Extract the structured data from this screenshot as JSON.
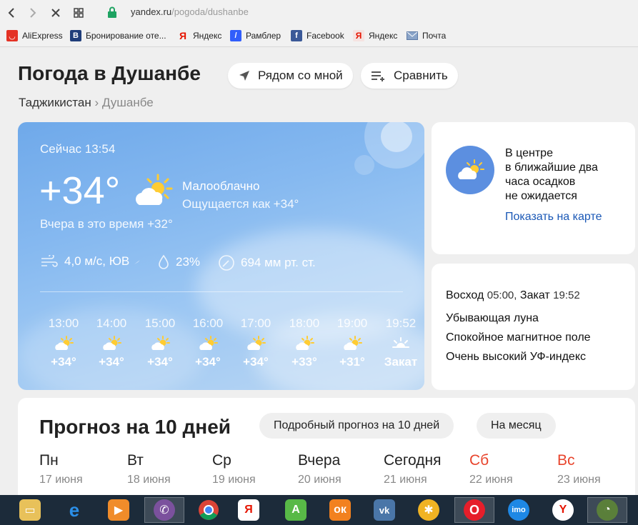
{
  "browser": {
    "url_host": "yandex.ru",
    "url_path": "/pogoda/dushanbe",
    "bookmarks": [
      {
        "label": "AliExpress",
        "icon": "aliexpress-icon"
      },
      {
        "label": "Бронирование оте...",
        "icon": "booking-icon"
      },
      {
        "label": "Яндекс",
        "icon": "yandex-icon"
      },
      {
        "label": "Рамблер",
        "icon": "rambler-icon"
      },
      {
        "label": "Facebook",
        "icon": "facebook-icon"
      },
      {
        "label": "Яндекс",
        "icon": "yandex-icon"
      },
      {
        "label": "Почта",
        "icon": "mail-icon"
      }
    ]
  },
  "header": {
    "title": "Погода в Душанбе",
    "nearby_label": "Рядом со мной",
    "compare_label": "Сравнить"
  },
  "breadcrumb": {
    "country": "Таджикистан",
    "separator": "›",
    "city": "Душанбе"
  },
  "current": {
    "time_label": "Сейчас 13:54",
    "temperature": "+34°",
    "condition": "Малооблачно",
    "feels_like": "Ощущается как +34°",
    "yesterday": "Вчера в это время +32°",
    "wind": "4,0 м/с, ЮВ",
    "humidity": "23%",
    "pressure": "694 мм рт. ст."
  },
  "hourly": [
    {
      "time": "13:00",
      "value": "+34°",
      "icon": "partly-cloudy-icon"
    },
    {
      "time": "14:00",
      "value": "+34°",
      "icon": "partly-cloudy-icon"
    },
    {
      "time": "15:00",
      "value": "+34°",
      "icon": "partly-cloudy-icon"
    },
    {
      "time": "16:00",
      "value": "+34°",
      "icon": "partly-cloudy-icon"
    },
    {
      "time": "17:00",
      "value": "+34°",
      "icon": "partly-cloudy-icon"
    },
    {
      "time": "18:00",
      "value": "+33°",
      "icon": "partly-cloudy-icon"
    },
    {
      "time": "19:00",
      "value": "+31°",
      "icon": "partly-cloudy-icon"
    },
    {
      "time": "19:52",
      "value": "Закат",
      "icon": "sunset-icon"
    }
  ],
  "precipitation": {
    "line1": "В центре",
    "line2": "в ближайшие два",
    "line3": "часа осадков",
    "line4": "не ожидается",
    "map_link": "Показать на карте"
  },
  "sun_info": {
    "sunrise_label": "Восход",
    "sunrise_time": "05:00,",
    "sunset_label": "Закат",
    "sunset_time": "19:52",
    "moon": "Убывающая луна",
    "magnetic": "Спокойное магнитное поле",
    "uv": "Очень высокий УФ-индекс"
  },
  "forecast": {
    "title": "Прогноз на 10 дней",
    "detailed_label": "Подробный прогноз на 10 дней",
    "month_label": "На месяц",
    "days": [
      {
        "name": "Пн",
        "date": "17 июня",
        "weekend": false
      },
      {
        "name": "Вт",
        "date": "18 июня",
        "weekend": false
      },
      {
        "name": "Ср",
        "date": "19 июня",
        "weekend": false
      },
      {
        "name": "Вчера",
        "date": "20 июня",
        "weekend": false
      },
      {
        "name": "Сегодня",
        "date": "21 июня",
        "weekend": false
      },
      {
        "name": "Сб",
        "date": "22 июня",
        "weekend": true
      },
      {
        "name": "Вс",
        "date": "23 июня",
        "weekend": true
      }
    ]
  },
  "colors": {
    "accent_link": "#1a58b6",
    "weekend": "#e8442c",
    "card_blue": "#6fa9ea"
  }
}
